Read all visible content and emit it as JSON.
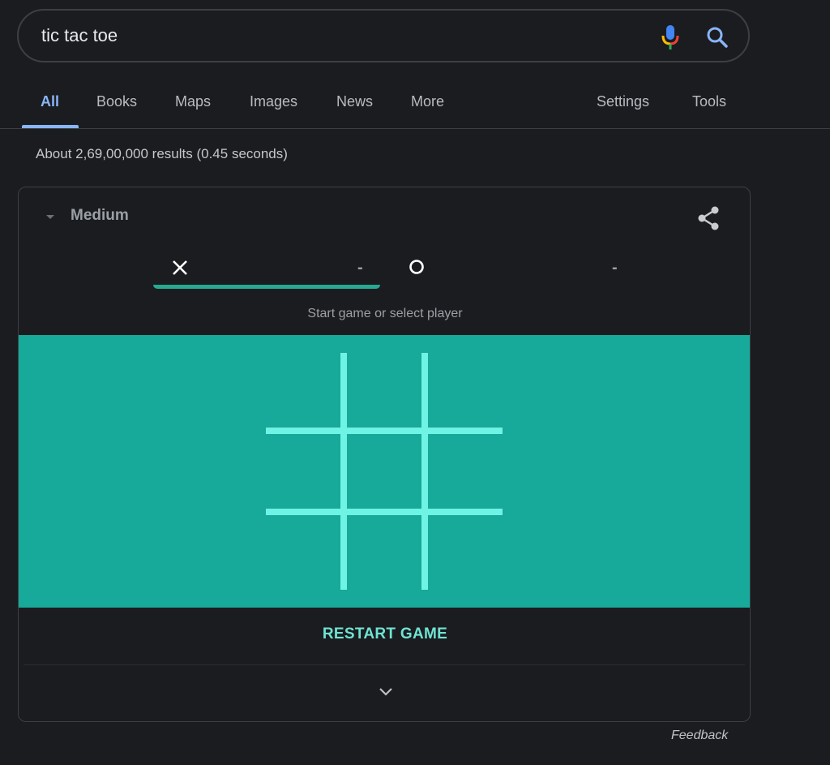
{
  "search": {
    "query": "tic tac toe",
    "mic_icon": "microphone-icon",
    "search_icon": "magnifier-icon"
  },
  "tabs": {
    "items": [
      {
        "label": "All",
        "active": true
      },
      {
        "label": "Books"
      },
      {
        "label": "Maps"
      },
      {
        "label": "Images"
      },
      {
        "label": "News"
      },
      {
        "label": "More"
      }
    ],
    "settings_label": "Settings",
    "tools_label": "Tools"
  },
  "results": {
    "stats": "About 2,69,00,000 results (0.45 seconds)"
  },
  "game": {
    "difficulty": "Medium",
    "share_icon": "share-icon",
    "players": [
      {
        "symbol": "X",
        "score": "-",
        "selected": true
      },
      {
        "symbol": "O",
        "score": "-",
        "selected": false
      }
    ],
    "status": "Start game or select player",
    "board": [
      "",
      "",
      "",
      "",
      "",
      "",
      "",
      "",
      ""
    ],
    "restart_label": "RESTART GAME",
    "expand_icon": "chevron-down-icon",
    "colors": {
      "board_bg": "#17a99a",
      "grid_lines": "#6ff3e4",
      "accent": "#6fe3d2",
      "active_tab": "#8ab4f8"
    }
  },
  "footer": {
    "feedback_label": "Feedback"
  }
}
